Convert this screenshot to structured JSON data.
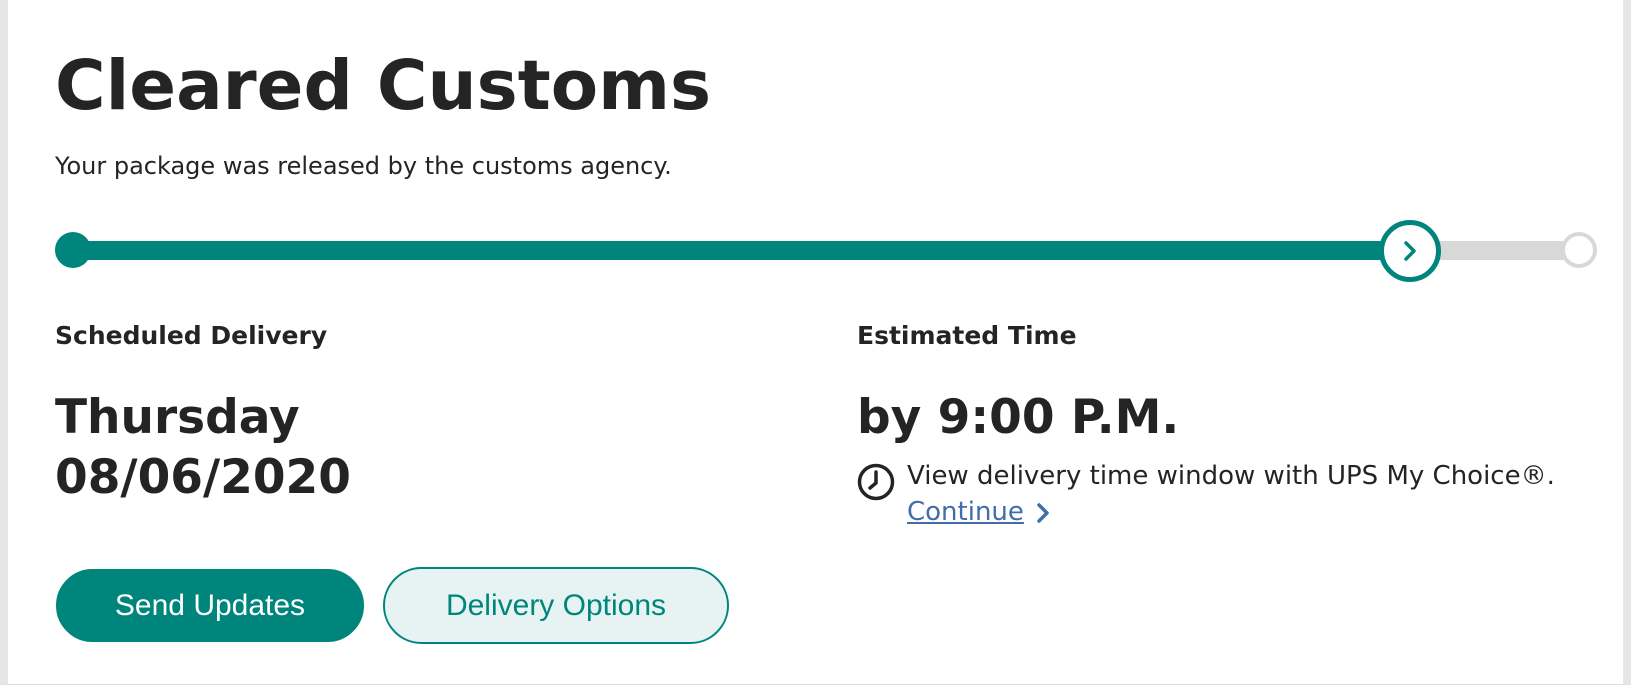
{
  "status": {
    "title": "Cleared Customs",
    "description": "Your package was released by the customs agency."
  },
  "progress": {
    "fraction_complete": 0.885,
    "current_step": 2,
    "total_steps": 3
  },
  "delivery": {
    "scheduled_label": "Scheduled Delivery",
    "day": "Thursday",
    "date": "08/06/2020",
    "estimated_label": "Estimated Time",
    "estimated_time": "by 9:00 P.M."
  },
  "my_choice": {
    "icon": "clock-icon",
    "text": "View delivery time window with UPS My Choice®.",
    "link_label": "Continue "
  },
  "actions": {
    "send_updates": "Send Updates",
    "delivery_options": "Delivery Options"
  },
  "colors": {
    "accent": "#00857c",
    "track": "#d8d8d8",
    "link": "#426da9",
    "text": "#242424",
    "secondary_button_bg": "#e6f3f2"
  }
}
